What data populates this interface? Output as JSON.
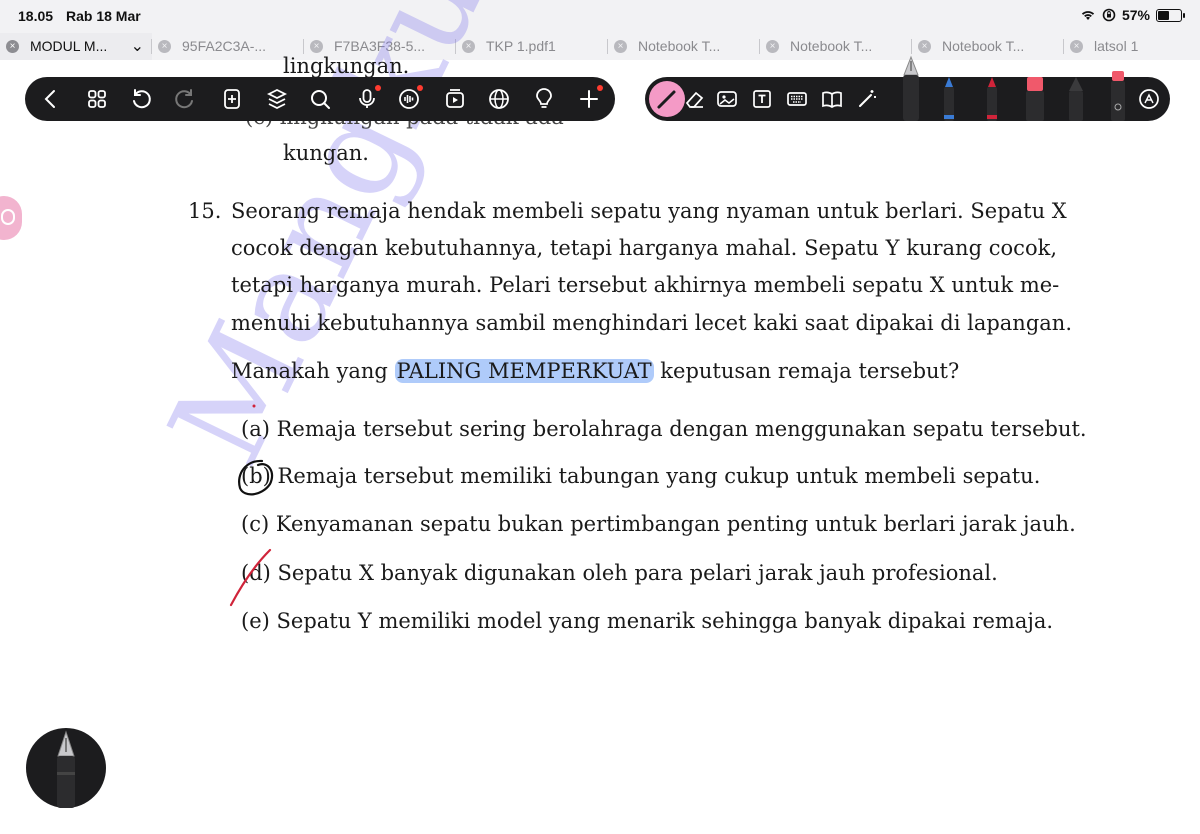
{
  "status": {
    "time": "18.05",
    "date": "Rab 18 Mar",
    "battery": "57%",
    "battery_level": 0.57
  },
  "tabs": [
    {
      "label": "MODUL M...",
      "active": true
    },
    {
      "label": "95FA2C3A-...",
      "active": false
    },
    {
      "label": "F7BA3F38-5...",
      "active": false
    },
    {
      "label": "TKP 1.pdf1",
      "active": false
    },
    {
      "label": "Notebook T...",
      "active": false
    },
    {
      "label": "Notebook T...",
      "active": false
    },
    {
      "label": "Notebook T...",
      "active": false
    },
    {
      "label": "latsol 1",
      "active": false
    }
  ],
  "toolbar": {
    "left_icons": [
      "back-icon",
      "grid-icon",
      "undo-icon",
      "redo-icon",
      "add-page-icon",
      "layers-icon",
      "search-icon",
      "microphone-icon",
      "audio-icon",
      "media-icon",
      "globe-icon",
      "bulb-icon",
      "plus-icon"
    ],
    "right_icons": [
      "pen-icon",
      "eraser-icon",
      "image-icon",
      "textbox-icon",
      "keyboard-icon",
      "book-icon",
      "magic-wand-icon"
    ],
    "pen_color": "#f49ac6"
  },
  "doc": {
    "prev_line_1": "lingkungan.",
    "prev_line_2": "(c)     lingkungan   pada    tidak ada",
    "prev_line_3": "kungan.",
    "question_number": "15.",
    "question_lines": [
      "Seorang remaja hendak membeli sepatu yang nyaman untuk berlari.  Sepatu X",
      "cocok dengan kebutuhannya, tetapi harganya mahal.  Sepatu Y kurang cocok,",
      "tetapi harganya murah.  Pelari tersebut akhirnya membeli sepatu X untuk me-",
      "menuhi kebutuhannya sambil menghindari lecet kaki saat dipakai di lapangan."
    ],
    "prompt_before": "Manakah yang ",
    "prompt_highlight": "PALING MEMPERKUAT",
    "prompt_after": " keputusan remaja tersebut?",
    "options": [
      {
        "key": "(a)",
        "text": "Remaja tersebut sering berolahraga dengan menggunakan sepatu tersebut."
      },
      {
        "key": "(b)",
        "text": "Remaja tersebut memiliki tabungan yang cukup untuk membeli sepatu."
      },
      {
        "key": "(c)",
        "text": "Kenyamanan sepatu bukan pertimbangan penting untuk berlari jarak jauh."
      },
      {
        "key": "(d)",
        "text": "Sepatu X banyak digunakan oleh para pelari jarak jauh profesional."
      },
      {
        "key": "(e)",
        "text": "Sepatu Y memiliki model yang menarik sehingga banyak dipakai remaja."
      }
    ],
    "watermark": "Mangkuk M",
    "highlight_color": "#6ea0f5",
    "ink_black": "#111111",
    "ink_red": "#d0243a"
  }
}
